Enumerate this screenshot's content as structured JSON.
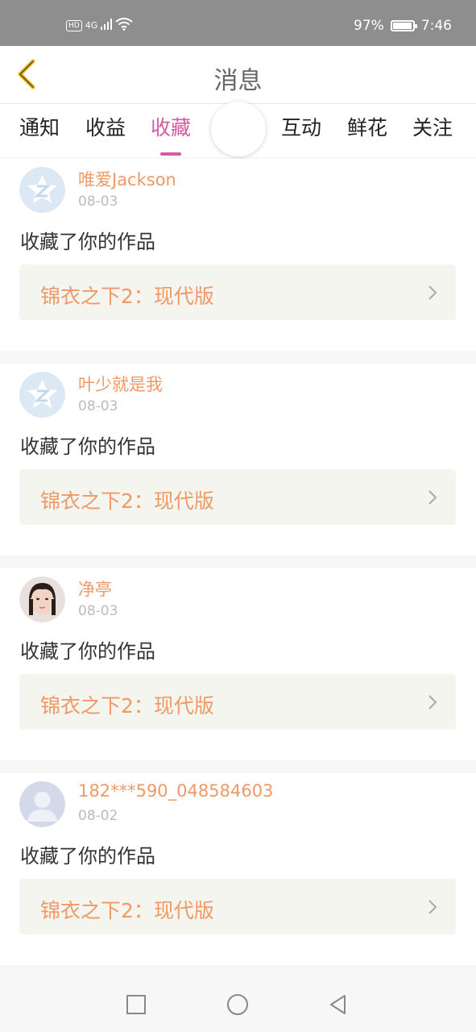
{
  "status_bar": {
    "hd": "HD",
    "network": "4G",
    "battery_percent": "97%",
    "battery_level": 0.97,
    "time": "7:46"
  },
  "header": {
    "title": "消息"
  },
  "tabs": [
    {
      "label": "通知",
      "active": false
    },
    {
      "label": "收益",
      "active": false
    },
    {
      "label": "收藏",
      "active": true
    },
    {
      "label": "互动",
      "active": false
    },
    {
      "label": "鲜花",
      "active": false
    },
    {
      "label": "关注",
      "active": false
    }
  ],
  "messages": [
    {
      "username": "唯爱Jackson",
      "date": "08-03",
      "action": "收藏了你的作品",
      "work_title": "锦衣之下2：现代版",
      "avatar": "qq-default-avatar"
    },
    {
      "username": "叶少就是我",
      "date": "08-03",
      "action": "收藏了你的作品",
      "work_title": "锦衣之下2：现代版",
      "avatar": "qq-default-avatar"
    },
    {
      "username": "净亭",
      "date": "08-03",
      "action": "收藏了你的作品",
      "work_title": "锦衣之下2：现代版",
      "avatar": "photo-avatar"
    },
    {
      "username": "182***590_048584603",
      "date": "08-02",
      "action": "收藏了你的作品",
      "work_title": "锦衣之下2：现代版",
      "avatar": "default-person-avatar"
    }
  ],
  "colors": {
    "accent": "#d55aa1",
    "username": "#ee9966",
    "back_arrow": "#e8b820"
  }
}
